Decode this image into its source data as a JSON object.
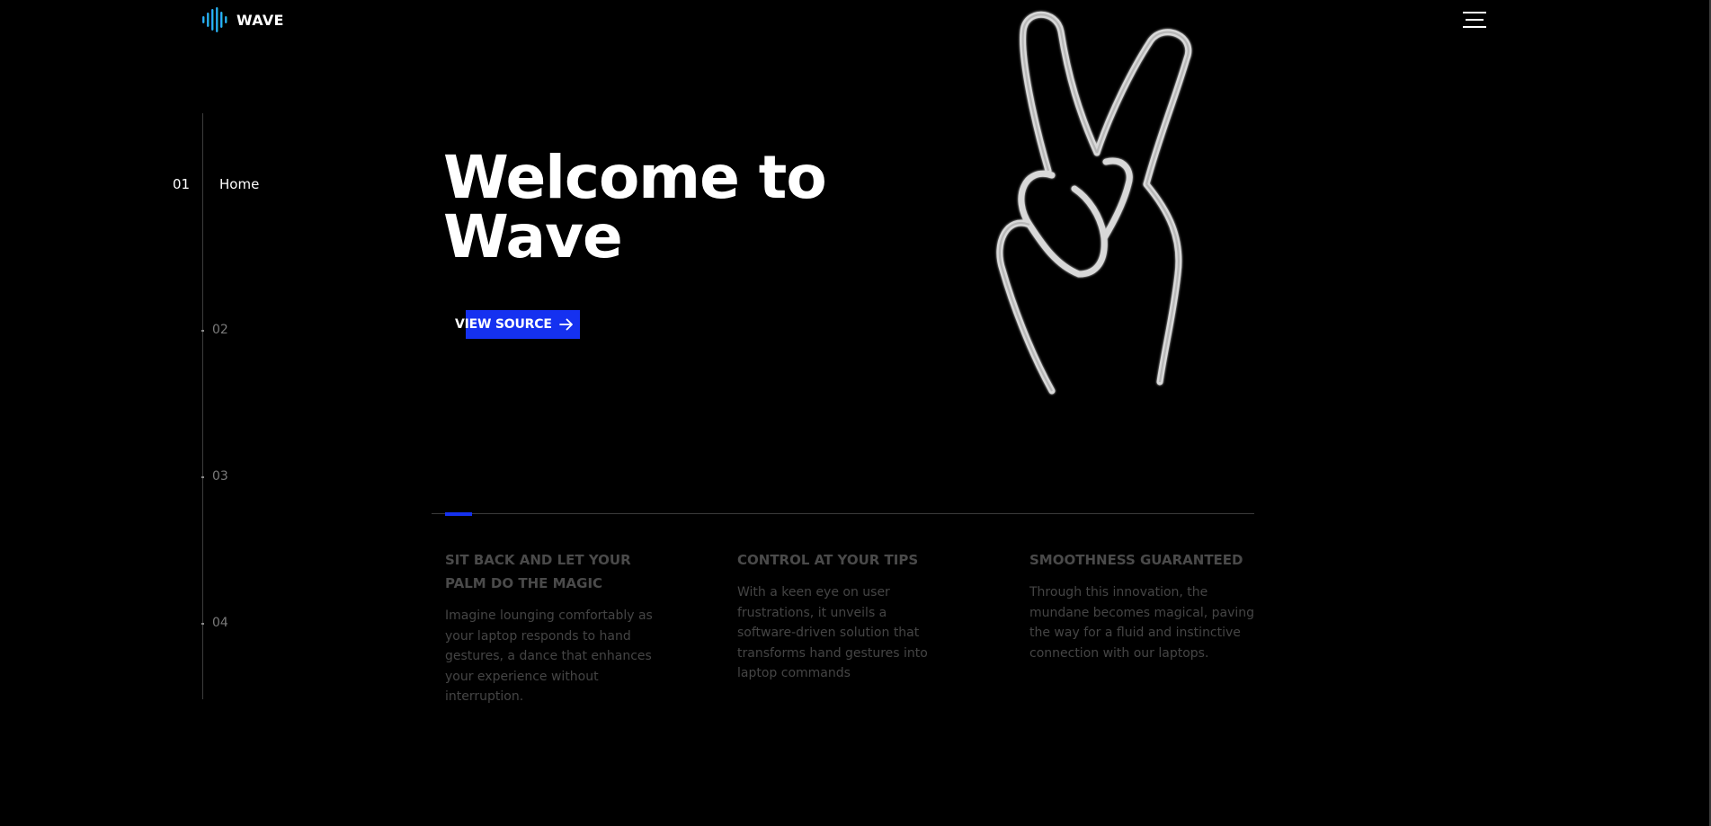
{
  "header": {
    "logo_text": "WAVE",
    "menu_icon": "hamburger-menu-icon"
  },
  "side_nav": {
    "active": {
      "number": "01",
      "label": "Home"
    },
    "items": [
      {
        "number": "02"
      },
      {
        "number": "03"
      },
      {
        "number": "04"
      }
    ]
  },
  "hero": {
    "title_line1": "Welcome to",
    "title_line2": "Wave",
    "cta_label": "VIEW SOURCE",
    "cta_icon": "arrow-right-icon",
    "image": "peace-sign-hand-icon"
  },
  "features": [
    {
      "title": "SIT BACK AND LET YOUR PALM DO THE MAGIC",
      "text": "Imagine lounging comfortably as your laptop responds to hand gestures, a dance that enhances your experience without interruption."
    },
    {
      "title": "CONTROL AT YOUR TIPS",
      "text": "With a keen eye on user frustrations, it unveils a software-driven solution that transforms hand gestures into laptop commands"
    },
    {
      "title": "SMOOTHNESS GUARANTEED",
      "text": "Through this innovation, the mundane becomes magical, paving the way for a fluid and instinctive connection with our laptops."
    }
  ],
  "colors": {
    "accent": "#1531f0",
    "logo_gradient_start": "#2f7bff",
    "logo_gradient_end": "#1fe0e0",
    "background": "#000000"
  }
}
